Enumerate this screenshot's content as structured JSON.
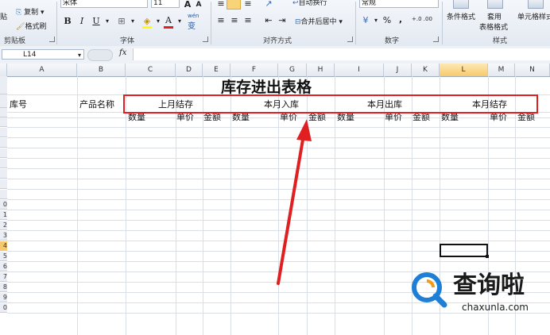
{
  "ribbon": {
    "clipboard": {
      "paste": "贴",
      "copy": "复制",
      "format_painter": "格式刷",
      "group_label": "剪贴板"
    },
    "font": {
      "font_name": "宋体",
      "font_size": "11",
      "bold": "B",
      "italic": "I",
      "underline": "U",
      "grow": "A",
      "shrink": "A",
      "wen": "wén",
      "wen_char": "变",
      "group_label": "字体"
    },
    "alignment": {
      "wrap_text": "自动换行",
      "merge_center": "合并后居中",
      "group_label": "对齐方式"
    },
    "number": {
      "format": "常规",
      "percent": "%",
      "comma": ",",
      "inc_decimal": "+.0 .00",
      "dec_decimal": ".00 →.0",
      "group_label": "数字"
    },
    "styles": {
      "conditional": "条件格式",
      "table_format_1": "套用",
      "table_format_2": "表格格式",
      "cell_styles": "单元格样式",
      "group_label": "样式"
    }
  },
  "formula_bar": {
    "name_box": "L14",
    "fx": "fx",
    "content": ""
  },
  "columns": [
    "A",
    "B",
    "C",
    "D",
    "E",
    "F",
    "G",
    "H",
    "I",
    "J",
    "K",
    "L",
    "M",
    "N"
  ],
  "selected_column": "L",
  "rows": [
    "",
    "",
    "",
    "",
    "",
    "",
    "",
    "",
    "0",
    "1",
    "2",
    "3",
    "4",
    "5",
    "6",
    "7",
    "8",
    "9",
    "0"
  ],
  "selected_row_label": "4",
  "sheet": {
    "title": "库存进出表格",
    "headers": {
      "warehouse_no": "库号",
      "product_name": "产品名称"
    },
    "groups": [
      "上月结存",
      "本月入库",
      "本月出库",
      "本月结存"
    ],
    "subheaders": {
      "qty": "数量",
      "price": "单价",
      "amount": "金额"
    }
  },
  "watermark": {
    "brand": "查询啦",
    "url": "chaxunla.com"
  },
  "colors": {
    "highlight_border": "#e02020",
    "arrow": "#e02020",
    "brand_blue": "#1d7fd6",
    "brand_orange": "#f39a1b"
  }
}
